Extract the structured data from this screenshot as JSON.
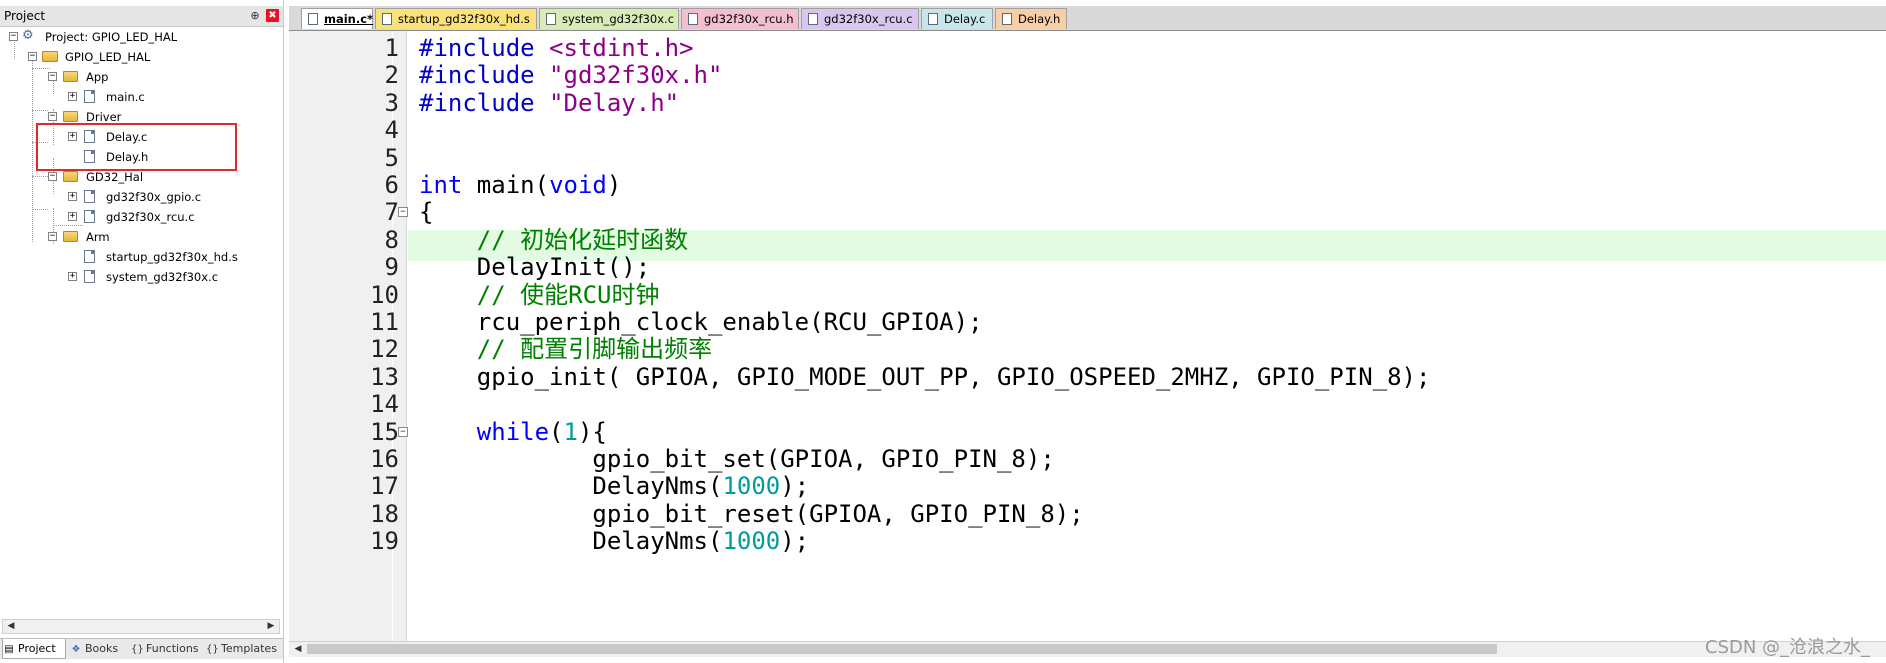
{
  "project_panel": {
    "title": "Project",
    "pin_glyph": "⊕",
    "close_glyph": "✖",
    "tree": {
      "root": "Project: GPIO_LED_HAL",
      "target": "GPIO_LED_HAL",
      "groups": [
        {
          "name": "App",
          "files": [
            "main.c"
          ]
        },
        {
          "name": "Driver",
          "files": [
            "Delay.c",
            "Delay.h"
          ]
        },
        {
          "name": "GD32_Hal",
          "files": [
            "gd32f30x_gpio.c",
            "gd32f30x_rcu.c"
          ]
        },
        {
          "name": "Arm",
          "files": [
            "startup_gd32f30x_hd.s",
            "system_gd32f30x.c"
          ]
        }
      ]
    },
    "bottom_tabs": [
      "Project",
      "Books",
      "Functions",
      "Templates"
    ]
  },
  "editor": {
    "tabs": [
      {
        "label": "main.c*",
        "color": "#ffffff",
        "active": true
      },
      {
        "label": "startup_gd32f30x_hd.s",
        "color": "#f9e27a"
      },
      {
        "label": "system_gd32f30x.c",
        "color": "#d9ecb7"
      },
      {
        "label": "gd32f30x_rcu.h",
        "color": "#f3bfcf"
      },
      {
        "label": "gd32f30x_rcu.c",
        "color": "#d8c6ee"
      },
      {
        "label": "Delay.c",
        "color": "#c8e6ea"
      },
      {
        "label": "Delay.h",
        "color": "#f7cfa6"
      }
    ],
    "current_line": 7,
    "lines": [
      {
        "n": "1",
        "code": "#include <stdint.h>"
      },
      {
        "n": "2",
        "code": "#include \"gd32f30x.h\""
      },
      {
        "n": "3",
        "code": "#include \"Delay.h\""
      },
      {
        "n": "4",
        "code": ""
      },
      {
        "n": "5",
        "code": ""
      },
      {
        "n": "6",
        "code": "int main(void)"
      },
      {
        "n": "7",
        "code": "{"
      },
      {
        "n": "8",
        "code": "    // 初始化延时函数"
      },
      {
        "n": "9",
        "code": "    DelayInit();"
      },
      {
        "n": "10",
        "code": "    // 使能RCU时钟"
      },
      {
        "n": "11",
        "code": "    rcu_periph_clock_enable(RCU_GPIOA);"
      },
      {
        "n": "12",
        "code": "    // 配置引脚输出频率"
      },
      {
        "n": "13",
        "code": "    gpio_init( GPIOA, GPIO_MODE_OUT_PP, GPIO_OSPEED_2MHZ, GPIO_PIN_8);"
      },
      {
        "n": "14",
        "code": ""
      },
      {
        "n": "15",
        "code": "    while(1){"
      },
      {
        "n": "16",
        "code": "            gpio_bit_set(GPIOA, GPIO_PIN_8);"
      },
      {
        "n": "17",
        "code": "            DelayNms(1000);"
      },
      {
        "n": "18",
        "code": "            gpio_bit_reset(GPIOA, GPIO_PIN_8);"
      },
      {
        "n": "19",
        "code": "            DelayNms(1000);"
      }
    ]
  },
  "watermark": "CSDN @_沧浪之水_"
}
